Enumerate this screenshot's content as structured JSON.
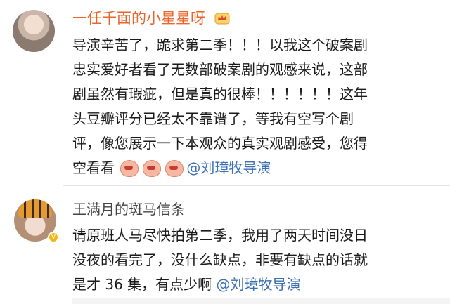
{
  "comments": [
    {
      "username": "一任千面的小星星呀",
      "lines": [
        "导演辛苦了，跪求第二季！！！以我这个破案剧",
        "忠实爱好者看了无数部破案剧的观感来说，这部",
        "剧虽然有瑕疵，但是真的很棒！！！！！！这年",
        "头豆瓣评分已经太不靠谱了，等我有空写个剧",
        "评，像您展示一下本观众的真实观剧感受，您得",
        "空看看"
      ],
      "mention": "@刘璋牧导演",
      "emoji_count": 3
    },
    {
      "username": "王满月的斑马信条",
      "lines": [
        "请原班人马尽快拍第二季，我用了两天时间没日",
        "没夜的看完了，没什么缺点，非要有缺点的话就",
        "是才 36 集，有点少啊"
      ],
      "mention": "@刘璋牧导演",
      "badge": "V"
    }
  ]
}
